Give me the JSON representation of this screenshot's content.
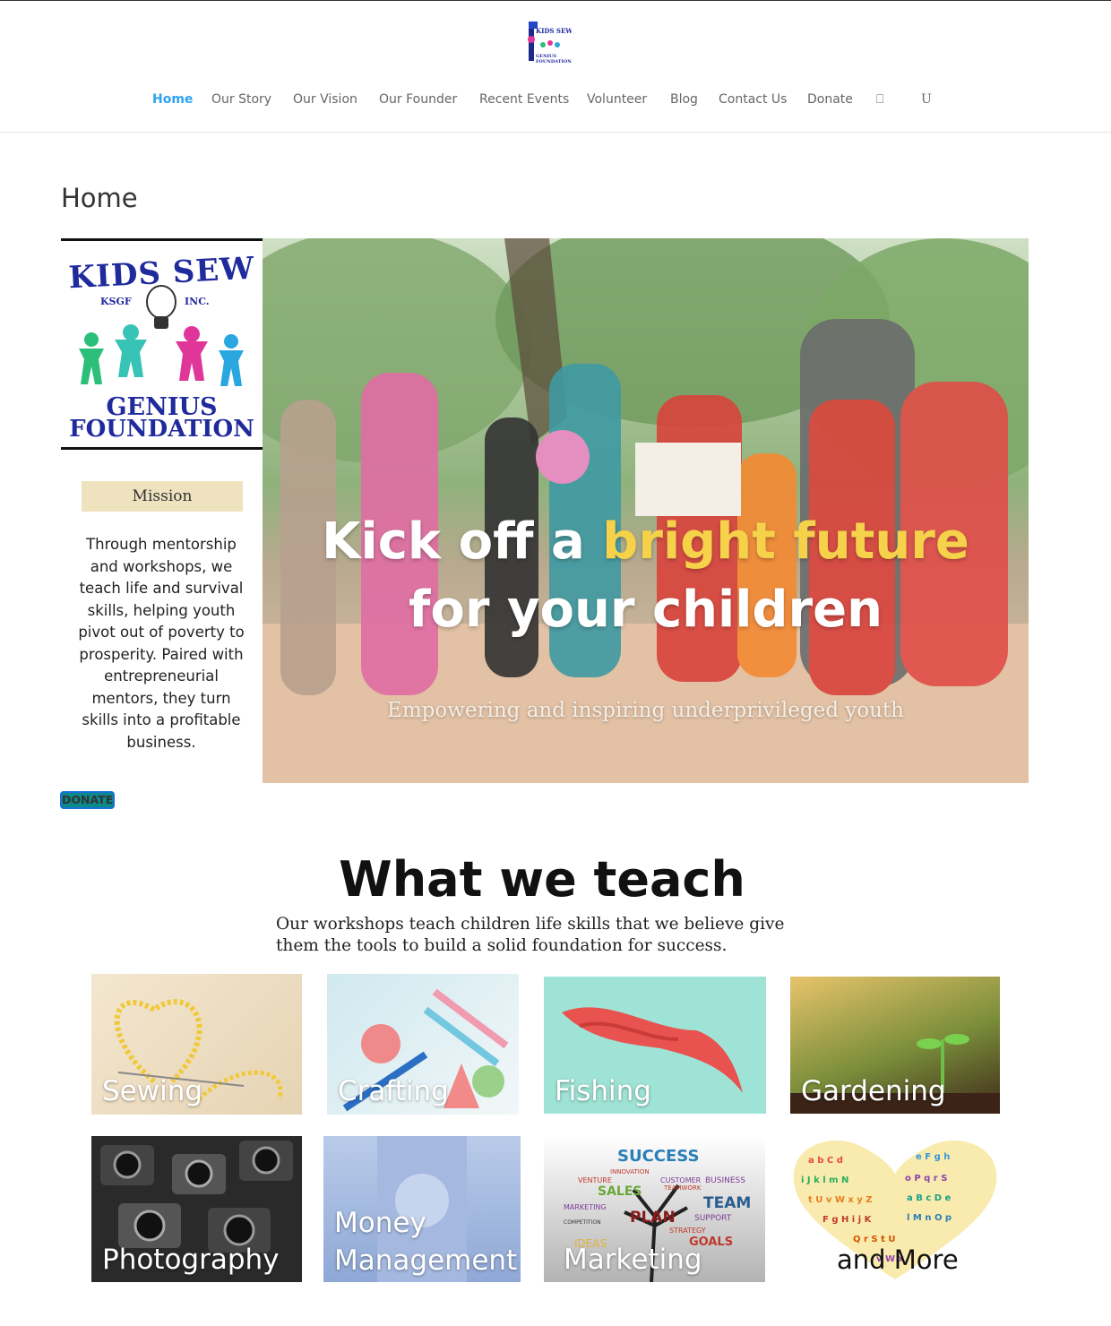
{
  "header": {
    "logo_alt": "Kids Sew Genius Foundation",
    "nav": [
      "Home",
      "Our Story",
      "Our Vision",
      "Our Founder",
      "Recent Events",
      "Volunteer",
      "Blog",
      "Contact Us",
      "Donate"
    ],
    "active": "Home",
    "icons": [
      "cart-icon",
      "search-icon"
    ],
    "icon_glyphs": [
      "⎕",
      "U"
    ]
  },
  "page": {
    "title": "Home"
  },
  "hero": {
    "logo": {
      "line1": "KIDS SEW",
      "left": "KSGF",
      "right": "INC.",
      "line2": "GENIUS",
      "line3": "FOUNDATION"
    },
    "mission_label": "Mission",
    "mission_text": "Through mentorship and workshops, we teach life and survival skills, helping youth pivot out of poverty to prosperity. Paired with entrepreneurial mentors, they turn skills into a profitable business.",
    "headline_a": "Kick off a ",
    "headline_highlight": "bright future",
    "headline_b": "for your children",
    "subline": "Empowering and inspiring underprivileged youth"
  },
  "donate_button": "DONATE",
  "teach": {
    "title": "What we teach",
    "subtitle": "Our workshops teach children life skills that we believe give them the tools to build a solid foundation for success.",
    "tiles": [
      "Sewing",
      "Crafting",
      "Fishing",
      "Gardening",
      "Photography",
      "Money Management",
      "Marketing",
      "and More"
    ],
    "marketing_words": [
      "SUCCESS",
      "INNOVATION",
      "VENTURE",
      "BUSINESS",
      "SALES",
      "TEAM",
      "MARKETING",
      "PLAN",
      "SUPPORT",
      "COMPETITION",
      "STRATEGY",
      "IDEAS",
      "GOALS",
      "CUSTOMER",
      "TEAMWORK"
    ]
  },
  "colors": {
    "accent": "#2ea3f2",
    "highlight": "#f6d24a",
    "donate_bg": "#0a8a8a"
  }
}
